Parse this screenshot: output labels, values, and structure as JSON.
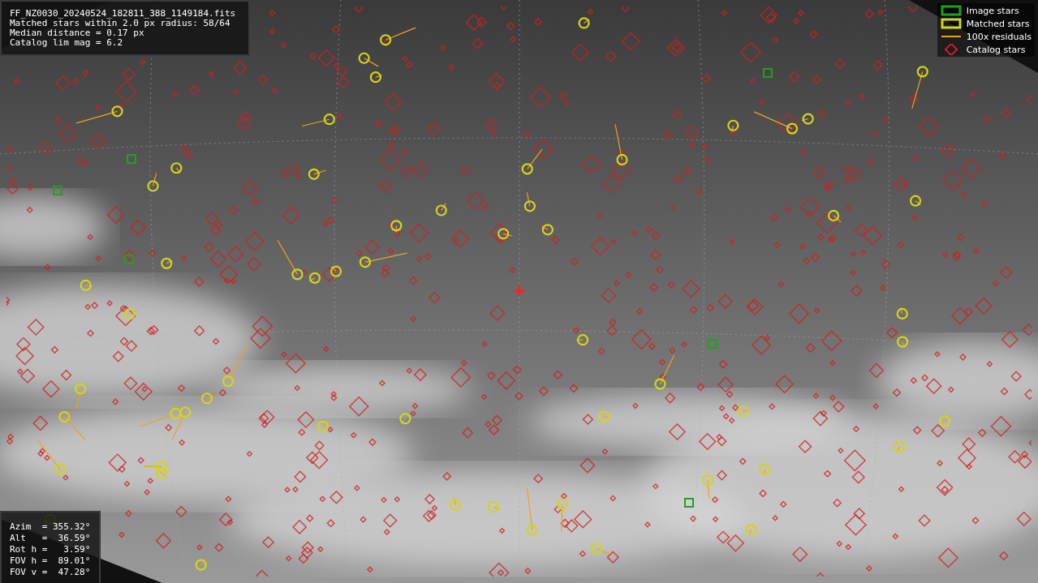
{
  "info_box": {
    "lines": [
      "FF_NZ0030_20240524_182811_388_1149184.fits",
      "Matched stars within 2.0 px radius: 58/64",
      "Median distance = 0.17 px",
      "Catalog lim mag = 6.2"
    ]
  },
  "legend": [
    {
      "kind": "box",
      "label": "Image stars",
      "color": "#1fa01f"
    },
    {
      "kind": "box",
      "label": "Matched stars",
      "color": "#d4d41a"
    },
    {
      "kind": "line",
      "label": "100x residuals",
      "color": "#f0a020"
    },
    {
      "kind": "diamond",
      "label": "Catalog stars",
      "color": "#d02020"
    }
  ],
  "pointing_box": {
    "lines": [
      "Azim  = 355.32°",
      "Alt   =  36.59°",
      "Rot h =   3.59°",
      "FOV h =  89.01°",
      "FOV v =  47.28°"
    ]
  }
}
